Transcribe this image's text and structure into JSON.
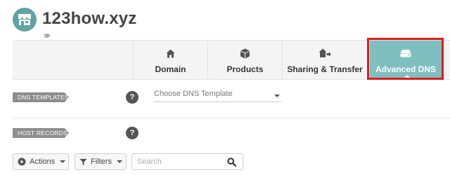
{
  "header": {
    "domain_name": "123how.xyz",
    "avatar_icon": "storefront-icon",
    "tag_icon": "tag-heart-icon"
  },
  "tabs": [
    {
      "label": "Domain",
      "icon": "home-icon",
      "active": false
    },
    {
      "label": "Products",
      "icon": "box-icon",
      "active": false
    },
    {
      "label": "Sharing & Transfer",
      "icon": "share-home-icon",
      "active": false
    },
    {
      "label": "Advanced DNS",
      "icon": "server-icon",
      "active": true
    }
  ],
  "sections": {
    "dns_templates": {
      "label": "DNS TEMPLATES",
      "help": "?",
      "select_value": "Choose DNS Template"
    },
    "host_records": {
      "label": "HOST RECORDS",
      "help": "?"
    }
  },
  "toolbar": {
    "actions_label": "Actions",
    "filters_label": "Filters",
    "search_placeholder": "Search"
  },
  "colors": {
    "accent": "#7fbfbf",
    "avatar": "#5fa3a3",
    "highlight": "#e01b1b"
  }
}
